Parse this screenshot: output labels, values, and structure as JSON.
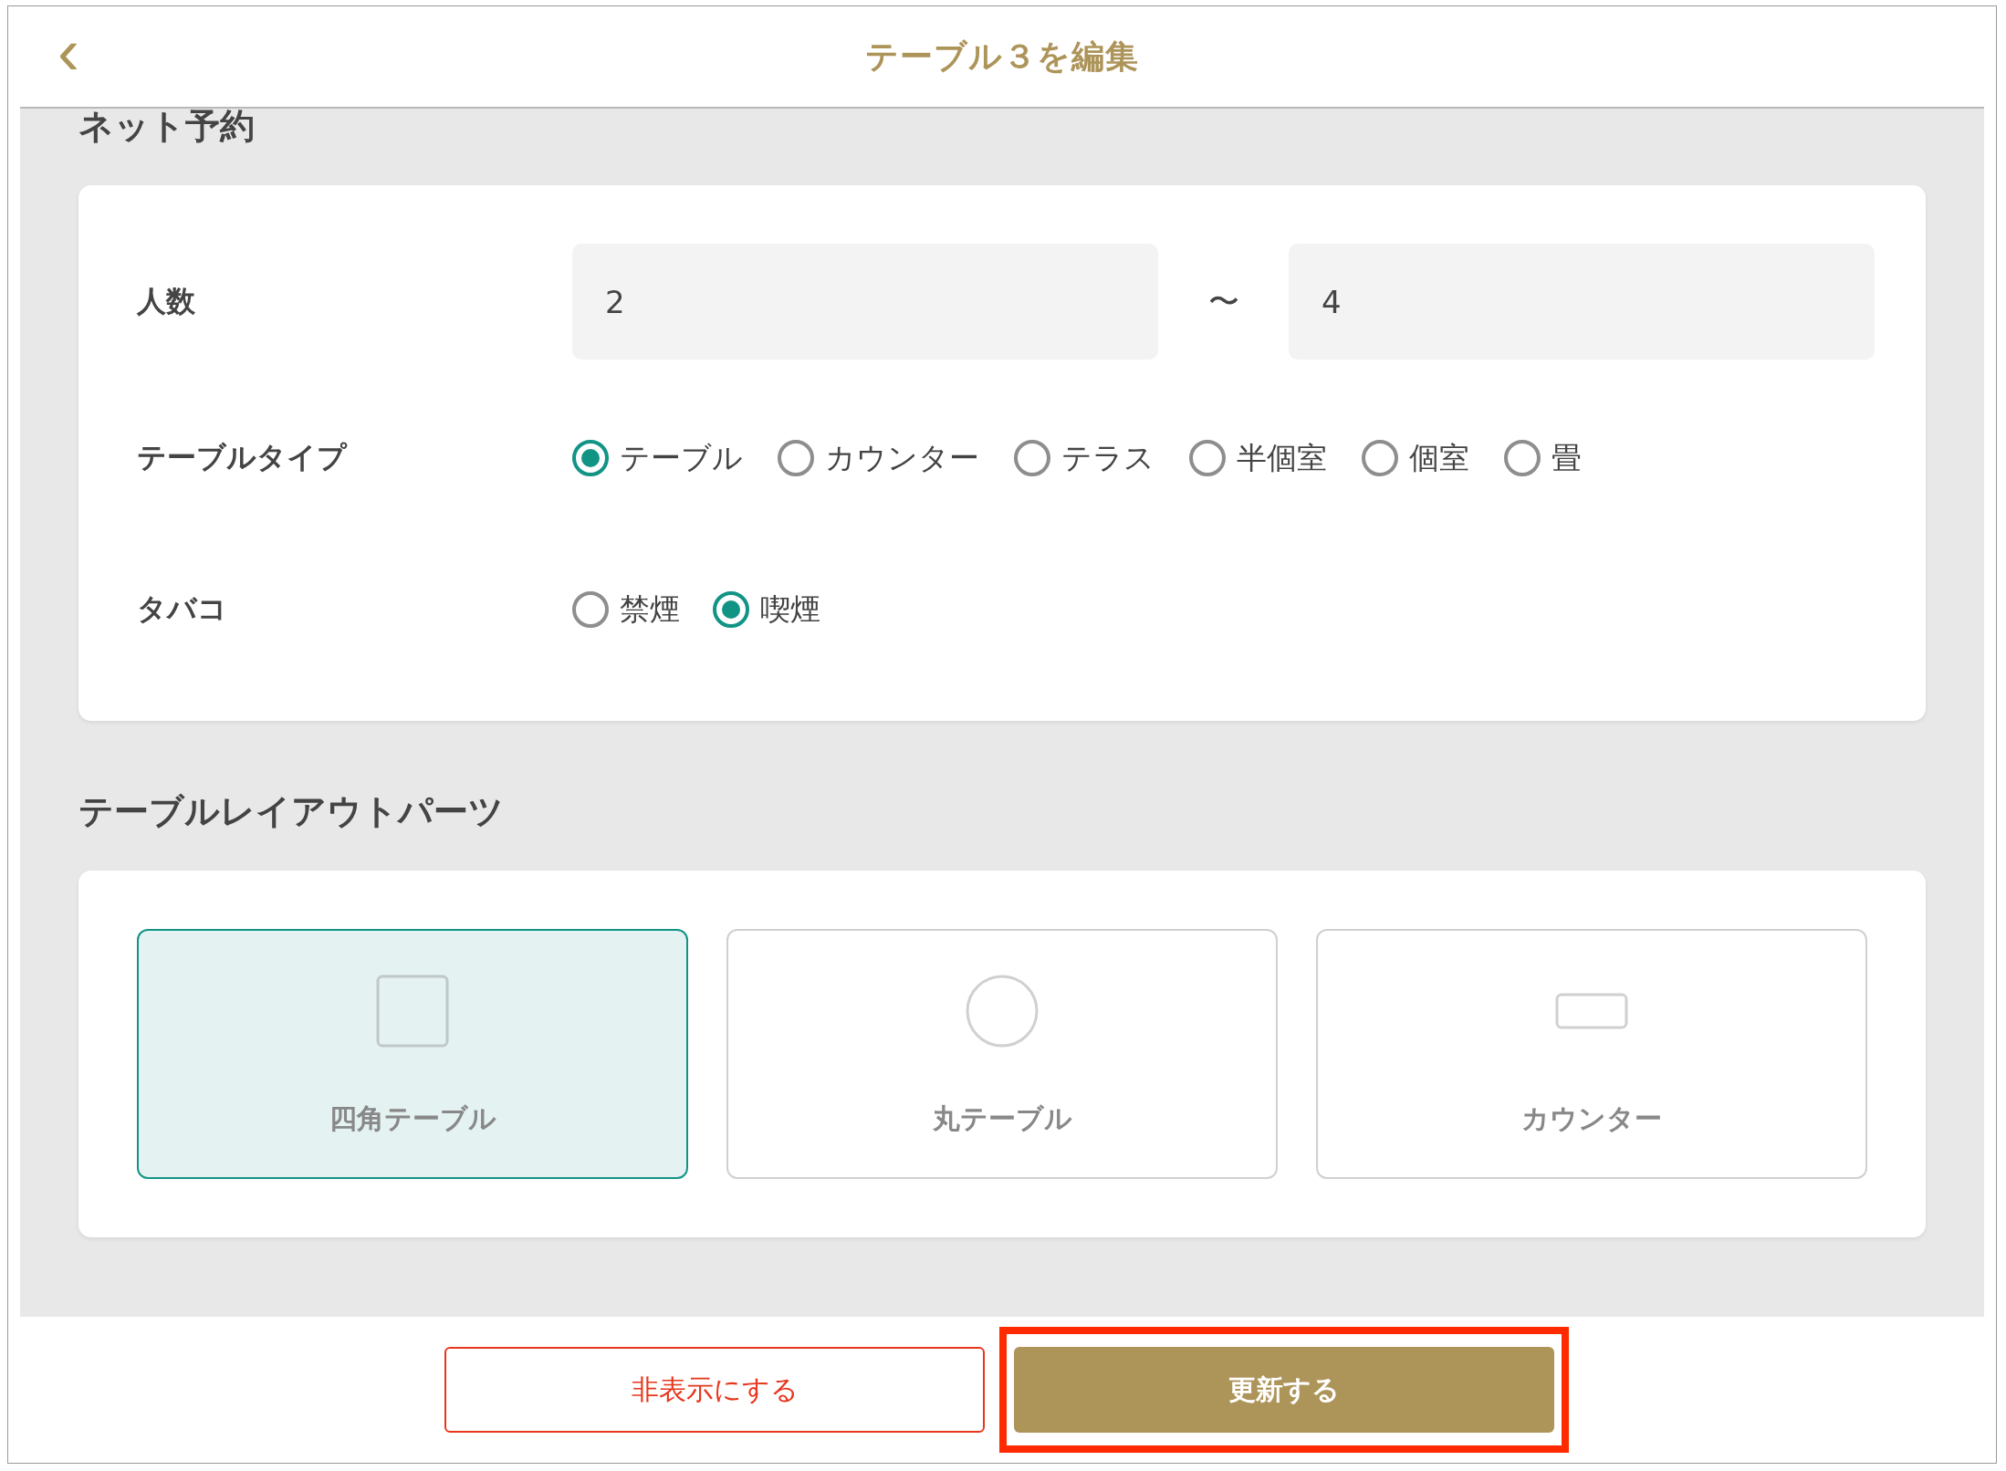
{
  "header": {
    "back_icon": "‹",
    "title": "テーブル３を編集"
  },
  "sections": [
    {
      "title": "ネット予約",
      "kind": "form"
    },
    {
      "title": "テーブルレイアウトパーツ",
      "kind": "parts"
    }
  ],
  "form": {
    "party_size": {
      "label": "人数",
      "min": "2",
      "separator": "〜",
      "max": "4"
    },
    "table_type": {
      "label": "テーブルタイプ",
      "options": [
        {
          "label": "テーブル",
          "selected": true
        },
        {
          "label": "カウンター",
          "selected": false
        },
        {
          "label": "テラス",
          "selected": false
        },
        {
          "label": "半個室",
          "selected": false
        },
        {
          "label": "個室",
          "selected": false
        },
        {
          "label": "畳",
          "selected": false
        }
      ]
    },
    "smoking": {
      "label": "タバコ",
      "options": [
        {
          "label": "禁煙",
          "selected": false
        },
        {
          "label": "喫煙",
          "selected": true
        }
      ]
    }
  },
  "parts": [
    {
      "kind": "square",
      "label": "四角テーブル",
      "selected": true
    },
    {
      "kind": "circle",
      "label": "丸テーブル",
      "selected": false
    },
    {
      "kind": "counter",
      "label": "カウンター",
      "selected": false
    }
  ],
  "buttons": [
    {
      "kind": "danger",
      "label": "非表示にする",
      "highlighted": false
    },
    {
      "kind": "primary",
      "label": "更新する",
      "highlighted": true
    }
  ]
}
